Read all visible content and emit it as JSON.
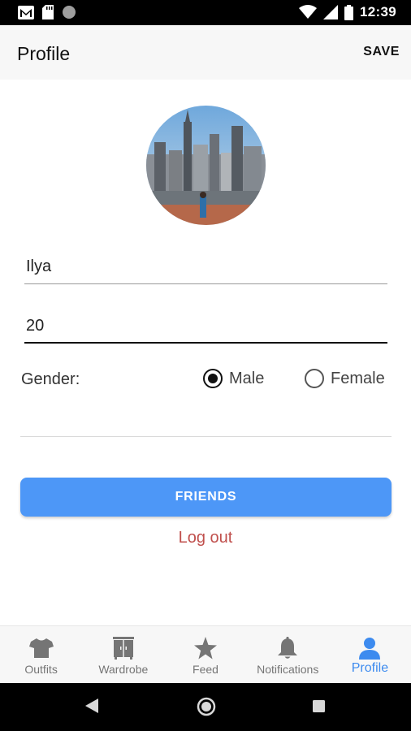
{
  "status_bar": {
    "time": "12:39"
  },
  "header": {
    "title": "Profile",
    "save_label": "SAVE"
  },
  "form": {
    "name_value": "Ilya",
    "age_value": "20",
    "gender_label": "Gender:",
    "gender_options": [
      {
        "label": "Male",
        "checked": true
      },
      {
        "label": "Female",
        "checked": false
      }
    ]
  },
  "actions": {
    "friends_label": "FRIENDS",
    "logout_label": "Log out"
  },
  "bottom_nav": {
    "items": [
      {
        "label": "Outfits",
        "icon": "shirt-icon"
      },
      {
        "label": "Wardrobe",
        "icon": "wardrobe-icon"
      },
      {
        "label": "Feed",
        "icon": "star-icon"
      },
      {
        "label": "Notifications",
        "icon": "bell-icon"
      },
      {
        "label": "Profile",
        "icon": "person-icon",
        "active": true
      }
    ]
  },
  "colors": {
    "accent": "#4d97f7",
    "active_tab": "#3d8bef",
    "logout": "#c0504d"
  }
}
